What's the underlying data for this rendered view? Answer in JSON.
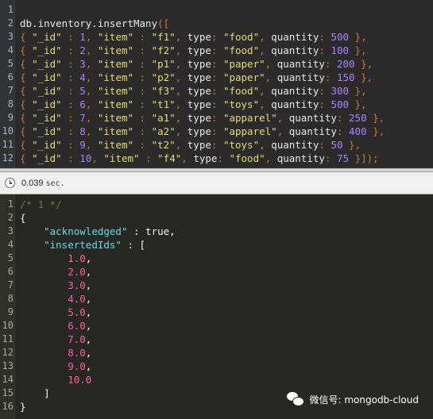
{
  "query_editor": {
    "lines": [
      {
        "n": "1",
        "tokens": []
      },
      {
        "n": "2",
        "tokens": [
          {
            "t": "db.inventory.insertMany",
            "c": "t-ident"
          },
          {
            "t": "([",
            "c": "t-punc"
          }
        ]
      },
      {
        "n": "3",
        "tokens": [
          {
            "t": "{ ",
            "c": "t-punc"
          },
          {
            "t": "\"_id\"",
            "c": "t-str"
          },
          {
            "t": " : ",
            "c": "t-punc"
          },
          {
            "t": "1",
            "c": "t-num"
          },
          {
            "t": ", ",
            "c": "t-punc"
          },
          {
            "t": "\"item\"",
            "c": "t-str"
          },
          {
            "t": " : ",
            "c": "t-punc"
          },
          {
            "t": "\"f1\"",
            "c": "t-str"
          },
          {
            "t": ", ",
            "c": "t-punc"
          },
          {
            "t": "type",
            "c": "t-key"
          },
          {
            "t": ": ",
            "c": "t-punc"
          },
          {
            "t": "\"food\"",
            "c": "t-str"
          },
          {
            "t": ", ",
            "c": "t-punc"
          },
          {
            "t": "quantity",
            "c": "t-key"
          },
          {
            "t": ": ",
            "c": "t-punc"
          },
          {
            "t": "500",
            "c": "t-num"
          },
          {
            "t": " },",
            "c": "t-punc"
          }
        ]
      },
      {
        "n": "4",
        "tokens": [
          {
            "t": "{ ",
            "c": "t-punc"
          },
          {
            "t": "\"_id\"",
            "c": "t-str"
          },
          {
            "t": " : ",
            "c": "t-punc"
          },
          {
            "t": "2",
            "c": "t-num"
          },
          {
            "t": ", ",
            "c": "t-punc"
          },
          {
            "t": "\"item\"",
            "c": "t-str"
          },
          {
            "t": " : ",
            "c": "t-punc"
          },
          {
            "t": "\"f2\"",
            "c": "t-str"
          },
          {
            "t": ", ",
            "c": "t-punc"
          },
          {
            "t": "type",
            "c": "t-key"
          },
          {
            "t": ": ",
            "c": "t-punc"
          },
          {
            "t": "\"food\"",
            "c": "t-str"
          },
          {
            "t": ", ",
            "c": "t-punc"
          },
          {
            "t": "quantity",
            "c": "t-key"
          },
          {
            "t": ": ",
            "c": "t-punc"
          },
          {
            "t": "100",
            "c": "t-num"
          },
          {
            "t": " },",
            "c": "t-punc"
          }
        ]
      },
      {
        "n": "5",
        "tokens": [
          {
            "t": "{ ",
            "c": "t-punc"
          },
          {
            "t": "\"_id\"",
            "c": "t-str"
          },
          {
            "t": " : ",
            "c": "t-punc"
          },
          {
            "t": "3",
            "c": "t-num"
          },
          {
            "t": ", ",
            "c": "t-punc"
          },
          {
            "t": "\"item\"",
            "c": "t-str"
          },
          {
            "t": " : ",
            "c": "t-punc"
          },
          {
            "t": "\"p1\"",
            "c": "t-str"
          },
          {
            "t": ", ",
            "c": "t-punc"
          },
          {
            "t": "type",
            "c": "t-key"
          },
          {
            "t": ": ",
            "c": "t-punc"
          },
          {
            "t": "\"paper\"",
            "c": "t-str"
          },
          {
            "t": ", ",
            "c": "t-punc"
          },
          {
            "t": "quantity",
            "c": "t-key"
          },
          {
            "t": ": ",
            "c": "t-punc"
          },
          {
            "t": "200",
            "c": "t-num"
          },
          {
            "t": " },",
            "c": "t-punc"
          }
        ]
      },
      {
        "n": "6",
        "tokens": [
          {
            "t": "{ ",
            "c": "t-punc"
          },
          {
            "t": "\"_id\"",
            "c": "t-str"
          },
          {
            "t": " : ",
            "c": "t-punc"
          },
          {
            "t": "4",
            "c": "t-num"
          },
          {
            "t": ", ",
            "c": "t-punc"
          },
          {
            "t": "\"item\"",
            "c": "t-str"
          },
          {
            "t": " : ",
            "c": "t-punc"
          },
          {
            "t": "\"p2\"",
            "c": "t-str"
          },
          {
            "t": ", ",
            "c": "t-punc"
          },
          {
            "t": "type",
            "c": "t-key"
          },
          {
            "t": ": ",
            "c": "t-punc"
          },
          {
            "t": "\"paper\"",
            "c": "t-str"
          },
          {
            "t": ", ",
            "c": "t-punc"
          },
          {
            "t": "quantity",
            "c": "t-key"
          },
          {
            "t": ": ",
            "c": "t-punc"
          },
          {
            "t": "150",
            "c": "t-num"
          },
          {
            "t": " },",
            "c": "t-punc"
          }
        ]
      },
      {
        "n": "7",
        "tokens": [
          {
            "t": "{ ",
            "c": "t-punc"
          },
          {
            "t": "\"_id\"",
            "c": "t-str"
          },
          {
            "t": " : ",
            "c": "t-punc"
          },
          {
            "t": "5",
            "c": "t-num"
          },
          {
            "t": ", ",
            "c": "t-punc"
          },
          {
            "t": "\"item\"",
            "c": "t-str"
          },
          {
            "t": " : ",
            "c": "t-punc"
          },
          {
            "t": "\"f3\"",
            "c": "t-str"
          },
          {
            "t": ", ",
            "c": "t-punc"
          },
          {
            "t": "type",
            "c": "t-key"
          },
          {
            "t": ": ",
            "c": "t-punc"
          },
          {
            "t": "\"food\"",
            "c": "t-str"
          },
          {
            "t": ", ",
            "c": "t-punc"
          },
          {
            "t": "quantity",
            "c": "t-key"
          },
          {
            "t": ": ",
            "c": "t-punc"
          },
          {
            "t": "300",
            "c": "t-num"
          },
          {
            "t": " },",
            "c": "t-punc"
          }
        ]
      },
      {
        "n": "8",
        "tokens": [
          {
            "t": "{ ",
            "c": "t-punc"
          },
          {
            "t": "\"_id\"",
            "c": "t-str"
          },
          {
            "t": " : ",
            "c": "t-punc"
          },
          {
            "t": "6",
            "c": "t-num"
          },
          {
            "t": ", ",
            "c": "t-punc"
          },
          {
            "t": "\"item\"",
            "c": "t-str"
          },
          {
            "t": " : ",
            "c": "t-punc"
          },
          {
            "t": "\"t1\"",
            "c": "t-str"
          },
          {
            "t": ", ",
            "c": "t-punc"
          },
          {
            "t": "type",
            "c": "t-key"
          },
          {
            "t": ": ",
            "c": "t-punc"
          },
          {
            "t": "\"toys\"",
            "c": "t-str"
          },
          {
            "t": ", ",
            "c": "t-punc"
          },
          {
            "t": "quantity",
            "c": "t-key"
          },
          {
            "t": ": ",
            "c": "t-punc"
          },
          {
            "t": "500",
            "c": "t-num"
          },
          {
            "t": " },",
            "c": "t-punc"
          }
        ]
      },
      {
        "n": "9",
        "tokens": [
          {
            "t": "{ ",
            "c": "t-punc"
          },
          {
            "t": "\"_id\"",
            "c": "t-str"
          },
          {
            "t": " : ",
            "c": "t-punc"
          },
          {
            "t": "7",
            "c": "t-num"
          },
          {
            "t": ", ",
            "c": "t-punc"
          },
          {
            "t": "\"item\"",
            "c": "t-str"
          },
          {
            "t": " : ",
            "c": "t-punc"
          },
          {
            "t": "\"a1\"",
            "c": "t-str"
          },
          {
            "t": ", ",
            "c": "t-punc"
          },
          {
            "t": "type",
            "c": "t-key"
          },
          {
            "t": ": ",
            "c": "t-punc"
          },
          {
            "t": "\"apparel\"",
            "c": "t-str"
          },
          {
            "t": ", ",
            "c": "t-punc"
          },
          {
            "t": "quantity",
            "c": "t-key"
          },
          {
            "t": ": ",
            "c": "t-punc"
          },
          {
            "t": "250",
            "c": "t-num"
          },
          {
            "t": " },",
            "c": "t-punc"
          }
        ]
      },
      {
        "n": "10",
        "tokens": [
          {
            "t": "{ ",
            "c": "t-punc"
          },
          {
            "t": "\"_id\"",
            "c": "t-str"
          },
          {
            "t": " : ",
            "c": "t-punc"
          },
          {
            "t": "8",
            "c": "t-num"
          },
          {
            "t": ", ",
            "c": "t-punc"
          },
          {
            "t": "\"item\"",
            "c": "t-str"
          },
          {
            "t": " : ",
            "c": "t-punc"
          },
          {
            "t": "\"a2\"",
            "c": "t-str"
          },
          {
            "t": ", ",
            "c": "t-punc"
          },
          {
            "t": "type",
            "c": "t-key"
          },
          {
            "t": ": ",
            "c": "t-punc"
          },
          {
            "t": "\"apparel\"",
            "c": "t-str"
          },
          {
            "t": ", ",
            "c": "t-punc"
          },
          {
            "t": "quantity",
            "c": "t-key"
          },
          {
            "t": ": ",
            "c": "t-punc"
          },
          {
            "t": "400",
            "c": "t-num"
          },
          {
            "t": " },",
            "c": "t-punc"
          }
        ]
      },
      {
        "n": "11",
        "tokens": [
          {
            "t": "{ ",
            "c": "t-punc"
          },
          {
            "t": "\"_id\"",
            "c": "t-str"
          },
          {
            "t": " : ",
            "c": "t-punc"
          },
          {
            "t": "9",
            "c": "t-num"
          },
          {
            "t": ", ",
            "c": "t-punc"
          },
          {
            "t": "\"item\"",
            "c": "t-str"
          },
          {
            "t": " : ",
            "c": "t-punc"
          },
          {
            "t": "\"t2\"",
            "c": "t-str"
          },
          {
            "t": ", ",
            "c": "t-punc"
          },
          {
            "t": "type",
            "c": "t-key"
          },
          {
            "t": ": ",
            "c": "t-punc"
          },
          {
            "t": "\"toys\"",
            "c": "t-str"
          },
          {
            "t": ", ",
            "c": "t-punc"
          },
          {
            "t": "quantity",
            "c": "t-key"
          },
          {
            "t": ": ",
            "c": "t-punc"
          },
          {
            "t": "50",
            "c": "t-num"
          },
          {
            "t": " },",
            "c": "t-punc"
          }
        ]
      },
      {
        "n": "12",
        "tokens": [
          {
            "t": "{ ",
            "c": "t-punc"
          },
          {
            "t": "\"_id\"",
            "c": "t-str"
          },
          {
            "t": " : ",
            "c": "t-punc"
          },
          {
            "t": "10",
            "c": "t-num"
          },
          {
            "t": ", ",
            "c": "t-punc"
          },
          {
            "t": "\"item\"",
            "c": "t-str"
          },
          {
            "t": " : ",
            "c": "t-punc"
          },
          {
            "t": "\"f4\"",
            "c": "t-str"
          },
          {
            "t": ", ",
            "c": "t-punc"
          },
          {
            "t": "type",
            "c": "t-key"
          },
          {
            "t": ": ",
            "c": "t-punc"
          },
          {
            "t": "\"food\"",
            "c": "t-str"
          },
          {
            "t": ", ",
            "c": "t-punc"
          },
          {
            "t": "quantity",
            "c": "t-key"
          },
          {
            "t": ": ",
            "c": "t-punc"
          },
          {
            "t": "75",
            "c": "t-num"
          },
          {
            "t": " }]);",
            "c": "t-punc"
          }
        ]
      }
    ]
  },
  "status": {
    "icon": "clock-icon",
    "elapsed": "0.039",
    "unit": "sec."
  },
  "result_viewer": {
    "lines": [
      {
        "n": "1",
        "tokens": [
          {
            "t": "/* 1 */",
            "c": "t-cmt"
          }
        ]
      },
      {
        "n": "2",
        "tokens": [
          {
            "t": "{",
            "c": "t-punc"
          }
        ]
      },
      {
        "n": "3",
        "tokens": [
          {
            "t": "    ",
            "c": "t-punc"
          },
          {
            "t": "\"acknowledged\"",
            "c": "t-str"
          },
          {
            "t": " : ",
            "c": "t-punc"
          },
          {
            "t": "true",
            "c": "t-bool"
          },
          {
            "t": ",",
            "c": "t-punc"
          }
        ]
      },
      {
        "n": "4",
        "tokens": [
          {
            "t": "    ",
            "c": "t-punc"
          },
          {
            "t": "\"insertedIds\"",
            "c": "t-str"
          },
          {
            "t": " : [",
            "c": "t-punc"
          }
        ]
      },
      {
        "n": "5",
        "tokens": [
          {
            "t": "        ",
            "c": "t-punc"
          },
          {
            "t": "1.0",
            "c": "t-num"
          },
          {
            "t": ",",
            "c": "t-punc"
          }
        ]
      },
      {
        "n": "6",
        "tokens": [
          {
            "t": "        ",
            "c": "t-punc"
          },
          {
            "t": "2.0",
            "c": "t-num"
          },
          {
            "t": ",",
            "c": "t-punc"
          }
        ]
      },
      {
        "n": "7",
        "tokens": [
          {
            "t": "        ",
            "c": "t-punc"
          },
          {
            "t": "3.0",
            "c": "t-num"
          },
          {
            "t": ",",
            "c": "t-punc"
          }
        ]
      },
      {
        "n": "8",
        "tokens": [
          {
            "t": "        ",
            "c": "t-punc"
          },
          {
            "t": "4.0",
            "c": "t-num"
          },
          {
            "t": ",",
            "c": "t-punc"
          }
        ]
      },
      {
        "n": "9",
        "tokens": [
          {
            "t": "        ",
            "c": "t-punc"
          },
          {
            "t": "5.0",
            "c": "t-num"
          },
          {
            "t": ",",
            "c": "t-punc"
          }
        ]
      },
      {
        "n": "10",
        "tokens": [
          {
            "t": "        ",
            "c": "t-punc"
          },
          {
            "t": "6.0",
            "c": "t-num"
          },
          {
            "t": ",",
            "c": "t-punc"
          }
        ]
      },
      {
        "n": "11",
        "tokens": [
          {
            "t": "        ",
            "c": "t-punc"
          },
          {
            "t": "7.0",
            "c": "t-num"
          },
          {
            "t": ",",
            "c": "t-punc"
          }
        ]
      },
      {
        "n": "12",
        "tokens": [
          {
            "t": "        ",
            "c": "t-punc"
          },
          {
            "t": "8.0",
            "c": "t-num"
          },
          {
            "t": ",",
            "c": "t-punc"
          }
        ]
      },
      {
        "n": "13",
        "tokens": [
          {
            "t": "        ",
            "c": "t-punc"
          },
          {
            "t": "9.0",
            "c": "t-num"
          },
          {
            "t": ",",
            "c": "t-punc"
          }
        ]
      },
      {
        "n": "14",
        "tokens": [
          {
            "t": "        ",
            "c": "t-punc"
          },
          {
            "t": "10.0",
            "c": "t-num"
          }
        ]
      },
      {
        "n": "15",
        "tokens": [
          {
            "t": "    ]",
            "c": "t-punc"
          }
        ]
      },
      {
        "n": "16",
        "tokens": [
          {
            "t": "}",
            "c": "t-punc"
          }
        ]
      }
    ]
  },
  "watermark": {
    "icon": "wechat-icon",
    "text": "微信号: mongodb-cloud"
  }
}
